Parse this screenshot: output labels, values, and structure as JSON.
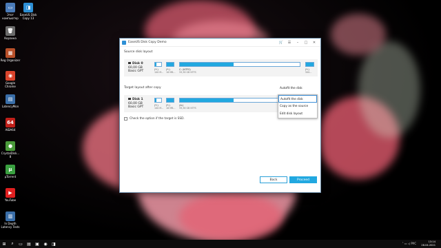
{
  "desktop_icons": [
    {
      "label": "Этот компьютер",
      "color": "#4a7bb8",
      "glyph": "▭",
      "icon": "computer-icon"
    },
    {
      "label": "EaseUS Disk Copy 13",
      "color": "#2d8fd5",
      "glyph": "◨",
      "icon": "easeus-icon"
    },
    {
      "label": "Корзина",
      "color": "#6b6b6b",
      "glyph": "🗑",
      "icon": "recycle-bin-icon"
    },
    {
      "label": "Reg Organizer",
      "color": "#b8502a",
      "glyph": "▦",
      "icon": "reg-organizer-icon"
    },
    {
      "label": "Google Chrome",
      "color": "#d9442c",
      "glyph": "◉",
      "icon": "chrome-icon"
    },
    {
      "label": "LatencyMon",
      "color": "#3a6ea8",
      "glyph": "▤",
      "icon": "latencymon-icon"
    },
    {
      "label": "AIDA64",
      "color": "#c0201a",
      "glyph": "64",
      "icon": "aida64-icon"
    },
    {
      "label": "CrystalDisk... 8",
      "color": "#4a9a3a",
      "glyph": "●",
      "icon": "crystaldisk-icon"
    },
    {
      "label": "µTorrent",
      "color": "#3aa040",
      "glyph": "µ",
      "icon": "utorrent-icon"
    },
    {
      "label": "YouTube",
      "color": "#e02020",
      "glyph": "▶",
      "icon": "youtube-icon"
    },
    {
      "label": "In Depth Latency Tests",
      "color": "#3a6ea8",
      "glyph": "▥",
      "icon": "latency-tests-icon"
    }
  ],
  "window": {
    "title": "EaseUS Disk Copy Demo",
    "controls": {
      "cart": "🛒",
      "menu": "☰",
      "minimize": "–",
      "maximize": "□",
      "close": "✕"
    }
  },
  "source": {
    "label": "Source disk layout",
    "disk": {
      "name": "Disk 0",
      "size": "60,00 GB",
      "type": "Basic GPT"
    },
    "partitions": [
      {
        "label": "(*:)",
        "size": "100 M...",
        "fill": 0.2
      },
      {
        "label": "(*:)",
        "size": "16 MB...",
        "fill": 1.0
      },
      {
        "label": "C: (NTFS)",
        "size": "59,38 GB NTFS",
        "fill": 0.45
      },
      {
        "label": "(*:)",
        "size": "500...",
        "fill": 1.0
      }
    ]
  },
  "target": {
    "label": "Target layout after copy",
    "disk": {
      "name": "Disk 1",
      "size": "60,00 GB",
      "type": "Basic GPT"
    },
    "partitions": [
      {
        "label": "(*:)",
        "size": "100 M...",
        "fill": 0.2
      },
      {
        "label": "(*:)",
        "size": "16 MB...",
        "fill": 1.0
      },
      {
        "label": "(A:)",
        "size": "59,38 GB NTFS",
        "fill": 0.45
      },
      {
        "label": "(*:)",
        "size": "500...",
        "fill": 1.0
      }
    ],
    "dropdown_value": "Autofit the disk",
    "dropdown_options": [
      "Autofit the disk",
      "Copy as the source",
      "Edit disk layout"
    ]
  },
  "checkbox_label": "Check the option if the target is SSD.",
  "buttons": {
    "back": "Back",
    "proceed": "Proceed"
  },
  "taskbar": {
    "time": "13:14",
    "date": "28.04.2021",
    "lang": "РУС",
    "icons": [
      "⊞",
      "⌕",
      "▭",
      "▤",
      "▣",
      "◉",
      "◨"
    ]
  }
}
